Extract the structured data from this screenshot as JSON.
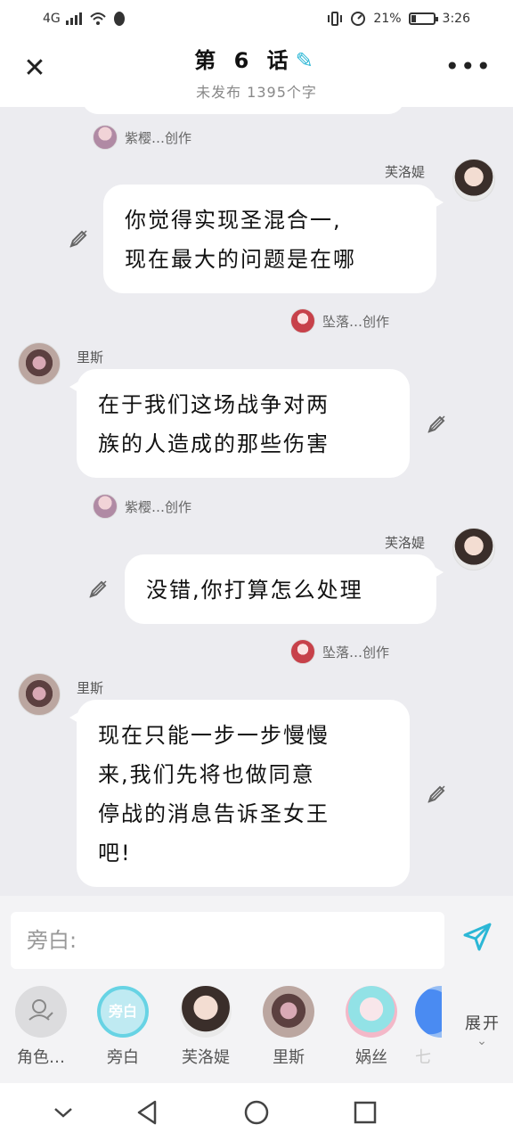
{
  "status": {
    "network": "4G",
    "battery": "21%",
    "battery_level": 0.21,
    "time": "3:26"
  },
  "header": {
    "title": "第 6 话",
    "subtitle": "未发布 1395个字"
  },
  "credits": [
    {
      "name": "紫樱…创作"
    },
    {
      "name": "坠落…创作"
    }
  ],
  "messages": [
    {
      "speaker": "芙洛媞",
      "text_lines": [
        "你觉得实现圣混合一,",
        "现在最大的问题是在哪"
      ]
    },
    {
      "speaker": "里斯",
      "text_lines": [
        "在于我们这场战争对两",
        "族的人造成的那些伤害"
      ]
    },
    {
      "speaker": "芙洛媞",
      "text_lines": [
        "没错,你打算怎么处理"
      ]
    },
    {
      "speaker": "里斯",
      "text_lines": [
        "现在只能一步一步慢慢",
        "来,我们先将也做同意",
        "停战的消息告诉圣女王",
        "吧!"
      ]
    }
  ],
  "input": {
    "placeholder": "旁白:"
  },
  "characters": [
    {
      "label": "角色…"
    },
    {
      "label": "旁白",
      "badge": "旁白"
    },
    {
      "label": "芙洛媞"
    },
    {
      "label": "里斯"
    },
    {
      "label": "娲丝"
    },
    {
      "label": "七"
    }
  ],
  "expand_label": "展开",
  "colors": {
    "accent": "#2bb7d6",
    "narration": "#67d3e4"
  }
}
